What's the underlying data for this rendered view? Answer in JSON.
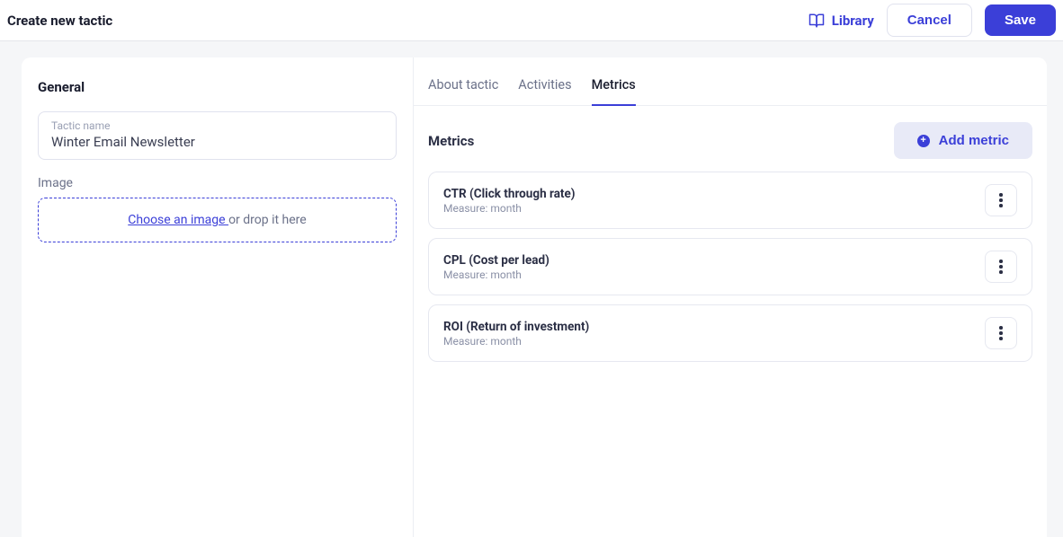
{
  "header": {
    "title": "Create new tactic",
    "library_label": "Library",
    "cancel_label": "Cancel",
    "save_label": "Save"
  },
  "general": {
    "title": "General",
    "tactic_name_label": "Tactic name",
    "tactic_name_value": "Winter Email Newsletter",
    "image_label": "Image",
    "choose_text": "Choose an image ",
    "drop_text": "or drop it here"
  },
  "tabs": {
    "about": "About tactic",
    "activities": "Activities",
    "metrics": "Metrics",
    "active": "metrics"
  },
  "metrics_section": {
    "title": "Metrics",
    "add_label": "Add metric",
    "items": [
      {
        "name": "CTR (Click through rate)",
        "measure": "Measure: month"
      },
      {
        "name": "CPL (Cost per lead)",
        "measure": "Measure: month"
      },
      {
        "name": "ROI (Return of investment)",
        "measure": "Measure: month"
      }
    ]
  }
}
